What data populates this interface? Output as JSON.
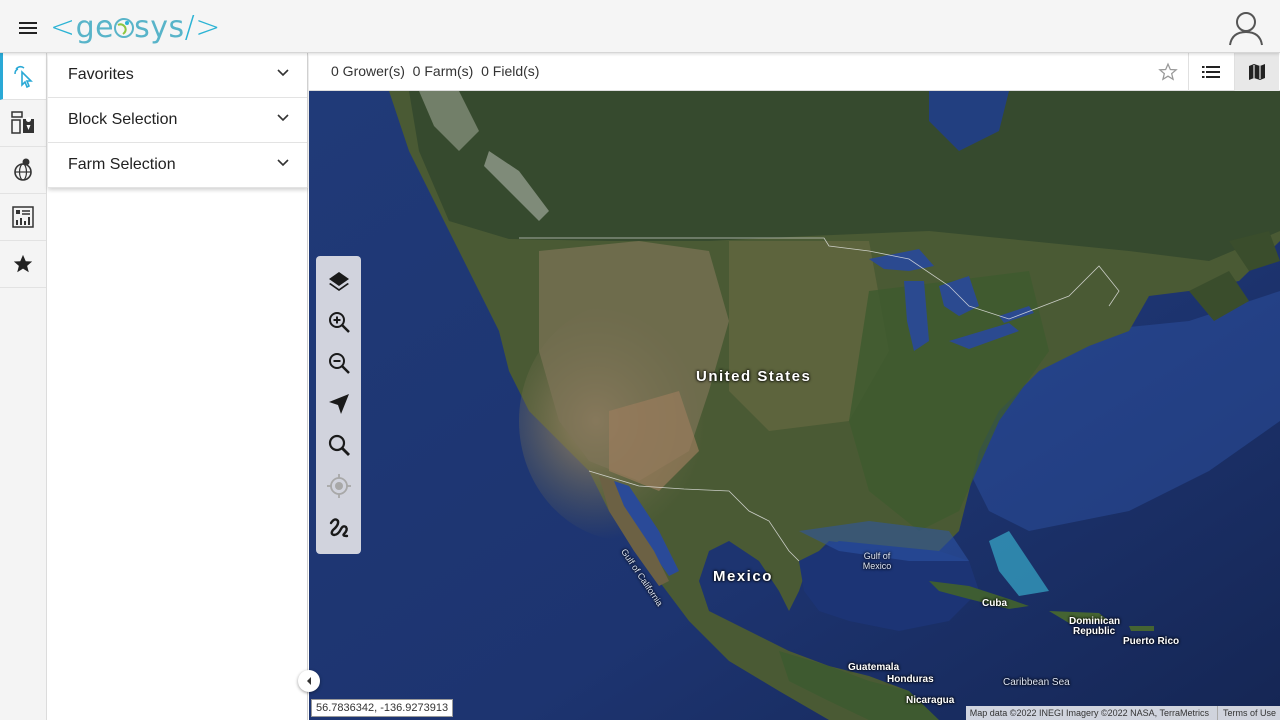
{
  "header": {
    "menu_icon": "hamburger-icon",
    "logo_left_bracket": "<",
    "logo_text_a": "ge",
    "logo_text_b": "sys",
    "logo_right_bracket": "/>",
    "user_icon": "user-icon"
  },
  "rail": {
    "items": [
      {
        "name": "selection",
        "icon": "pointer-select-icon",
        "active": true
      },
      {
        "name": "dashboard",
        "icon": "dashboard-location-icon",
        "active": false
      },
      {
        "name": "globe-analytics",
        "icon": "globe-icon",
        "active": false
      },
      {
        "name": "reports",
        "icon": "report-chart-icon",
        "active": false
      },
      {
        "name": "favorites",
        "icon": "star-icon",
        "active": false
      }
    ]
  },
  "panel": {
    "sections": [
      {
        "label": "Favorites"
      },
      {
        "label": "Block Selection"
      },
      {
        "label": "Farm Selection"
      }
    ]
  },
  "summary": {
    "text": "0 Grower(s)  0 Farm(s)  0 Field(s)",
    "favorite_icon": "star-outline-icon",
    "list_view_icon": "list-icon",
    "map_view_icon": "map-icon",
    "active_view": "map"
  },
  "map": {
    "labels": {
      "united_states": "United States",
      "mexico": "Mexico",
      "gulf_of_mexico_1": "Gulf of",
      "gulf_of_mexico_2": "Mexico",
      "gulf_of_california": "Gulf of California",
      "cuba": "Cuba",
      "dominican_republic_1": "Dominican",
      "dominican_republic_2": "Republic",
      "puerto_rico": "Puerto Rico",
      "guatemala": "Guatemala",
      "honduras": "Honduras",
      "nicaragua": "Nicaragua",
      "caribbean_sea": "Caribbean Sea"
    },
    "controls": [
      {
        "name": "layers",
        "icon": "layers-icon",
        "enabled": true
      },
      {
        "name": "zoom-in",
        "icon": "zoom-in-icon",
        "enabled": true
      },
      {
        "name": "zoom-out",
        "icon": "zoom-out-icon",
        "enabled": true
      },
      {
        "name": "navigate",
        "icon": "navigation-arrow-icon",
        "enabled": true
      },
      {
        "name": "search",
        "icon": "search-icon",
        "enabled": true
      },
      {
        "name": "locate",
        "icon": "crosshair-icon",
        "enabled": false
      },
      {
        "name": "draw",
        "icon": "freehand-draw-icon",
        "enabled": true
      }
    ],
    "coordinates": "56.7836342, -136.9273913",
    "attribution": "Map data ©2022 INEGI Imagery ©2022 NASA, TerraMetrics",
    "terms": "Terms of Use"
  }
}
